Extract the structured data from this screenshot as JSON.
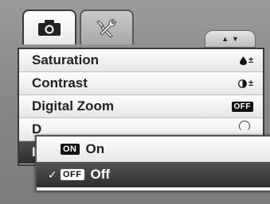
{
  "tabs": [
    {
      "name": "camera",
      "active": true
    },
    {
      "name": "setup",
      "active": false
    }
  ],
  "scroll": {
    "up": "▲",
    "down": "▼"
  },
  "menu": {
    "items": [
      {
        "label": "Saturation",
        "value_icon": "droplet-icon",
        "value_text": "±"
      },
      {
        "label": "Contrast",
        "value_icon": "contrast-icon",
        "value_text": "±"
      },
      {
        "label": "Digital Zoom",
        "value_badge": "OFF"
      },
      {
        "label": "D"
      },
      {
        "label": "I"
      }
    ]
  },
  "popup": {
    "options": [
      {
        "badge": "ON",
        "label": "On",
        "checked": false
      },
      {
        "badge": "OFF",
        "label": "Off",
        "checked": true,
        "check_mark": "✓"
      }
    ]
  }
}
